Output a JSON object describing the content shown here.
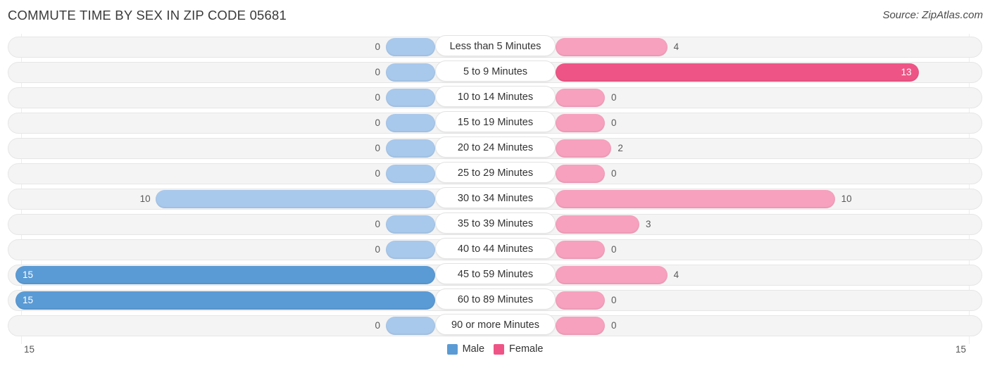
{
  "header": {
    "title": "COMMUTE TIME BY SEX IN ZIP CODE 05681",
    "source": "Source: ZipAtlas.com"
  },
  "legend": {
    "items": [
      {
        "label": "Male",
        "color": "#5b9bd5"
      },
      {
        "label": "Female",
        "color": "#ee5586"
      }
    ]
  },
  "axis": {
    "left_label": "15",
    "right_label": "15"
  },
  "chart_data": {
    "type": "bar",
    "title": "COMMUTE TIME BY SEX IN ZIP CODE 05681",
    "subtitle": "Source: ZipAtlas.com",
    "orientation": "horizontal-diverging",
    "xlabel": "",
    "ylabel": "",
    "xlim": [
      15,
      15
    ],
    "grid": false,
    "legend_position": "bottom-center",
    "categories": [
      "Less than 5 Minutes",
      "5 to 9 Minutes",
      "10 to 14 Minutes",
      "15 to 19 Minutes",
      "20 to 24 Minutes",
      "25 to 29 Minutes",
      "30 to 34 Minutes",
      "35 to 39 Minutes",
      "40 to 44 Minutes",
      "45 to 59 Minutes",
      "60 to 89 Minutes",
      "90 or more Minutes"
    ],
    "series": [
      {
        "name": "Male",
        "color": "#5b9bd5",
        "values": [
          0,
          0,
          0,
          0,
          0,
          0,
          10,
          0,
          0,
          15,
          15,
          0
        ]
      },
      {
        "name": "Female",
        "color": "#ee5586",
        "values": [
          4,
          13,
          0,
          0,
          2,
          0,
          10,
          3,
          0,
          4,
          0,
          0
        ]
      }
    ],
    "male_max": 15,
    "female_max": 13,
    "axis_max": 15
  }
}
